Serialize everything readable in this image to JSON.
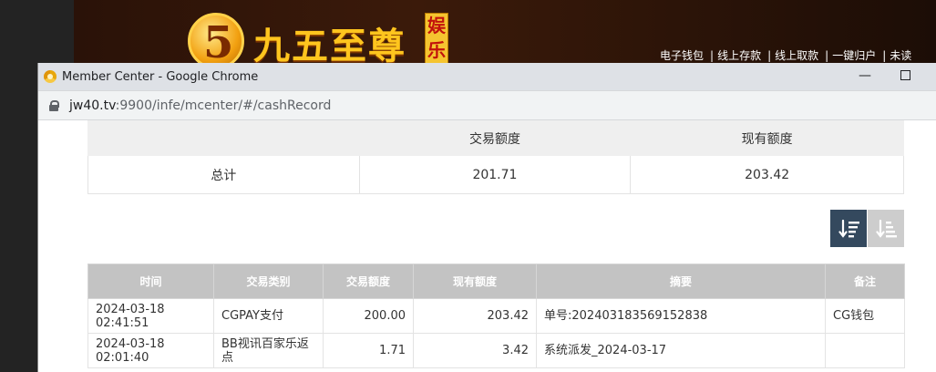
{
  "site": {
    "logo_glyph": "5",
    "logo_text": "九五至尊",
    "logo_badge": "娱乐",
    "top_links": [
      "电子钱包",
      "线上存款",
      "线上取款",
      "一键归户",
      "未读"
    ]
  },
  "window": {
    "title": "Member Center - Google Chrome",
    "minimize_glyph": "—",
    "url_host": "jw40.tv",
    "url_path": ":9900/infe/mcenter/#/cashRecord"
  },
  "summary": {
    "headers": [
      "",
      "交易额度",
      "现有额度"
    ],
    "row": [
      "总计",
      "201.71",
      "203.42"
    ]
  },
  "sort": {
    "desc_icon": "sort-descending-icon",
    "asc_icon": "sort-ascending-icon",
    "colors": {
      "active": "#34495e",
      "inactive": "#cdcdcd"
    }
  },
  "records": {
    "headers": [
      "时间",
      "交易类别",
      "交易额度",
      "现有额度",
      "摘要",
      "备注"
    ],
    "rows": [
      [
        "2024-03-18 02:41:51",
        "CGPAY支付",
        "200.00",
        "203.42",
        "单号:202403183569152838",
        "CG钱包"
      ],
      [
        "2024-03-18 02:01:40",
        "BB视讯百家乐返点",
        "1.71",
        "3.42",
        "系统派发_2024-03-17",
        ""
      ]
    ]
  }
}
